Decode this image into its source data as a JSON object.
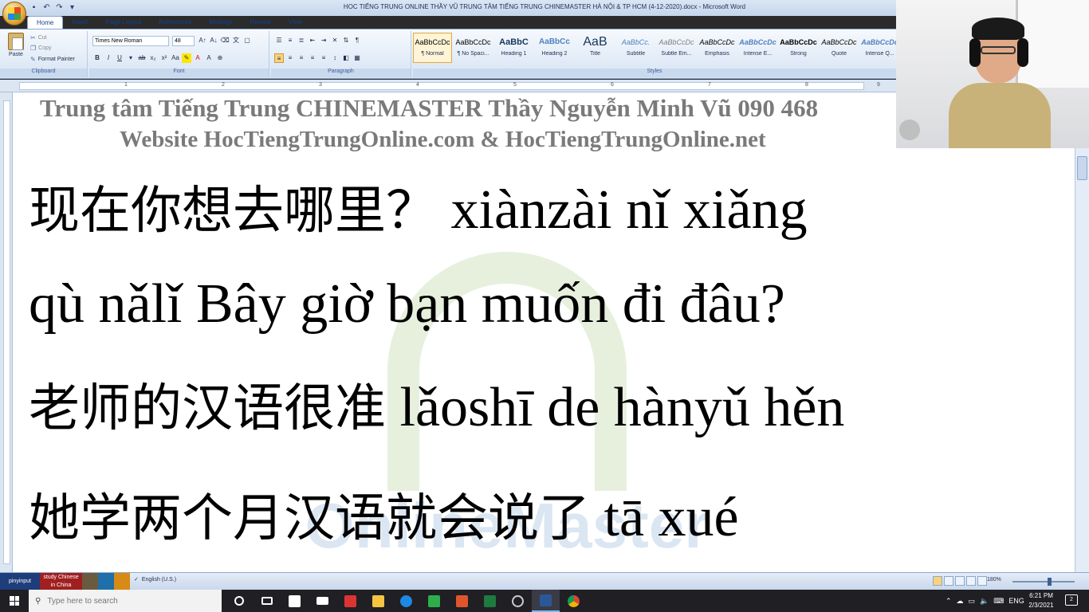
{
  "window": {
    "title": "HOC TIẾNG TRUNG ONLINE THẦY VŨ TRUNG TÂM TIẾNG TRUNG CHINEMASTER HÀ NỘI & TP HCM (4-12-2020).docx - Microsoft Word"
  },
  "ribbon": {
    "tabs": [
      "Home",
      "Insert",
      "Page Layout",
      "References",
      "Mailings",
      "Review",
      "View"
    ],
    "clipboard": {
      "paste": "Paste",
      "cut": "Cut",
      "copy": "Copy",
      "format_painter": "Format Painter",
      "label": "Clipboard"
    },
    "font": {
      "name": "Times New Roman",
      "size": "48",
      "label": "Font"
    },
    "paragraph": {
      "label": "Paragraph"
    },
    "styles": {
      "label": "Styles",
      "items": [
        {
          "preview": "AaBbCcDc",
          "name": "¶ Normal"
        },
        {
          "preview": "AaBbCcDc",
          "name": "¶ No Spaci..."
        },
        {
          "preview": "AaBbC",
          "name": "Heading 1"
        },
        {
          "preview": "AaBbCc",
          "name": "Heading 2"
        },
        {
          "preview": "AaB",
          "name": "Title"
        },
        {
          "preview": "AaBbCc.",
          "name": "Subtitle"
        },
        {
          "preview": "AaBbCcDc",
          "name": "Subtle Em..."
        },
        {
          "preview": "AaBbCcDc",
          "name": "Emphasis"
        },
        {
          "preview": "AaBbCcDc",
          "name": "Intense E..."
        },
        {
          "preview": "AaBbCcDc",
          "name": "Strong"
        },
        {
          "preview": "AaBbCcDc",
          "name": "Quote"
        },
        {
          "preview": "AaBbCcDc",
          "name": "Intense Q..."
        }
      ]
    }
  },
  "ruler": {
    "marks": [
      "1",
      "2",
      "3",
      "4",
      "5",
      "6",
      "7",
      "8",
      "9"
    ]
  },
  "document": {
    "header_line1": "Trung tâm Tiếng Trung CHINEMASTER Thầy Nguyễn Minh Vũ 090 468",
    "header_line2": "Website HocTiengTrungOnline.com & HocTiengTrungOnline.net",
    "lines": [
      {
        "hanzi": "现在你想去哪里？",
        "pinyin": " xiànzài nǐ xiǎng"
      },
      {
        "hanzi": "",
        "pinyin": "qù nǎlǐ Bây giờ bạn muốn đi đâu?"
      },
      {
        "hanzi": "老师的汉语很准",
        "pinyin": " lǎoshī de hànyǔ hěn"
      },
      {
        "hanzi": "她学两个月汉语就会说了",
        "pinyin": " tā xué"
      }
    ]
  },
  "statusbar": {
    "pinyininput": "pinyinput",
    "study_chinese": "study Chinese in China",
    "language": "English (U.S.)",
    "zoom": "180%"
  },
  "taskbar": {
    "search_placeholder": "Type here to search",
    "lang": "ENG",
    "time": "6:21 PM",
    "date": "2/3/2021",
    "notifications": "2"
  }
}
